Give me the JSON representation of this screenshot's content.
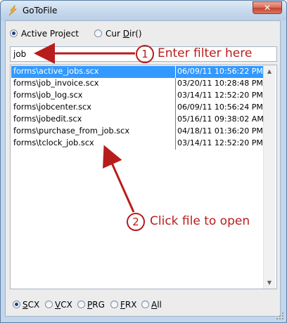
{
  "window": {
    "title": "GoToFile",
    "close_label": "✕"
  },
  "scope": {
    "options": [
      {
        "label": "Active Project",
        "checked": true
      },
      {
        "label": "Cur Dir()",
        "checked": false
      }
    ]
  },
  "filter": {
    "value": "job"
  },
  "files": {
    "rows": [
      {
        "name": "forms\\active_jobs.scx",
        "date": "06/09/11 10:56:22 PM",
        "selected": true
      },
      {
        "name": "forms\\job_invoice.scx",
        "date": "03/20/11 10:28:48 PM",
        "selected": false
      },
      {
        "name": "forms\\job_log.scx",
        "date": "03/14/11 12:52:20 PM",
        "selected": false
      },
      {
        "name": "forms\\jobcenter.scx",
        "date": "06/09/11 10:56:24 PM",
        "selected": false
      },
      {
        "name": "forms\\jobedit.scx",
        "date": "05/16/11 09:38:02 AM",
        "selected": false
      },
      {
        "name": "forms\\purchase_from_job.scx",
        "date": "04/18/11 01:36:20 PM",
        "selected": false
      },
      {
        "name": "forms\\tclock_job.scx",
        "date": "03/14/11 12:52:20 PM",
        "selected": false
      }
    ]
  },
  "extensions": {
    "options": [
      {
        "label": "SCX",
        "checked": true
      },
      {
        "label": "VCX",
        "checked": false
      },
      {
        "label": "PRG",
        "checked": false
      },
      {
        "label": "FRX",
        "checked": false
      },
      {
        "label": "All",
        "checked": false
      }
    ]
  },
  "annotations": {
    "step1_number": "1",
    "step1_text": "Enter filter here",
    "step2_number": "2",
    "step2_text": "Click file to open",
    "color": "#b81d1d"
  },
  "icons": {
    "app": "lightning-icon",
    "scroll_up": "chevron-up-icon",
    "scroll_down": "chevron-down-icon",
    "resize": "resize-grip-icon"
  }
}
